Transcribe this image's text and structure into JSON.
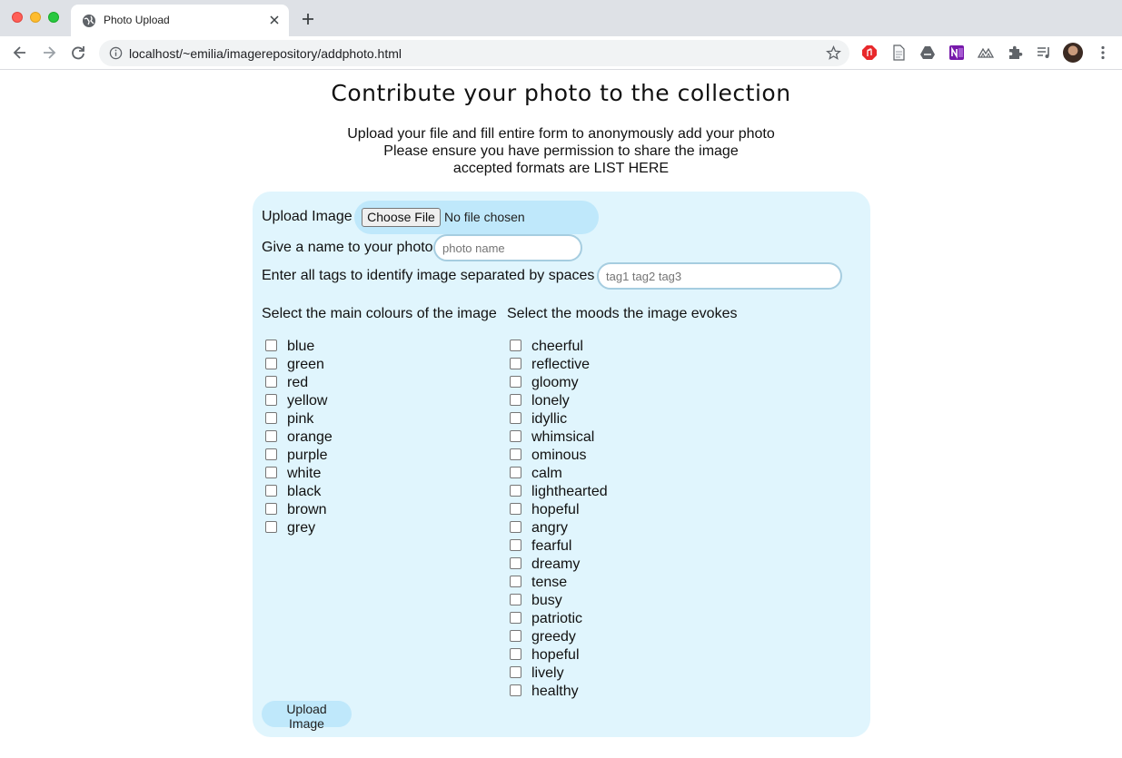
{
  "browser": {
    "tab_title": "Photo Upload",
    "url": "localhost/~emilia/imagerepository/addphoto.html"
  },
  "page": {
    "title": "Contribute your photo to the collection",
    "intro_lines": [
      "Upload your file and fill entire form to anonymously add your photo",
      "Please ensure you have permission to share the image",
      "accepted formats are LIST HERE"
    ]
  },
  "form": {
    "upload_label": "Upload Image",
    "choose_file_label": "Choose File",
    "no_file_text": "No file chosen",
    "name_label": "Give a name to your photo",
    "name_placeholder": "photo name",
    "tags_label": "Enter all tags to identify image separated by spaces",
    "tags_placeholder": "tag1 tag2 tag3",
    "colours_heading": "Select the main colours of the image",
    "moods_heading": "Select the moods the image evokes",
    "colours": [
      "blue",
      "green",
      "red",
      "yellow",
      "pink",
      "orange",
      "purple",
      "white",
      "black",
      "brown",
      "grey"
    ],
    "moods": [
      "cheerful",
      "reflective",
      "gloomy",
      "lonely",
      "idyllic",
      "whimsical",
      "ominous",
      "calm",
      "lighthearted",
      "hopeful",
      "angry",
      "fearful",
      "dreamy",
      "tense",
      "busy",
      "patriotic",
      "greedy",
      "hopeful",
      "lively",
      "healthy"
    ],
    "submit_label": "Upload Image"
  },
  "icons": {
    "tab_favicon": "globe-icon",
    "toolbar": [
      "back-arrow-icon",
      "forward-arrow-icon",
      "reload-icon",
      "info-icon",
      "bookmark-star-icon"
    ],
    "extensions": [
      "adblock-extension-icon",
      "document-extension-icon",
      "drive-extension-icon",
      "onenote-extension-icon",
      "mountains-extension-icon",
      "puzzle-extensions-icon",
      "reading-list-icon",
      "profile-avatar",
      "menu-kebab-icon"
    ]
  },
  "colors": {
    "panel_background": "#e0f5fd",
    "pill_background": "#bfe8fb",
    "tabbar_background": "#dee1e6"
  }
}
